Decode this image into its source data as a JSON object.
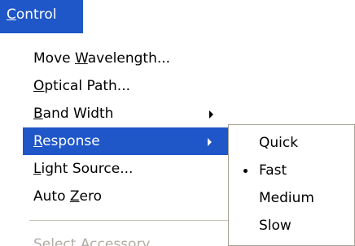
{
  "menubar": {
    "active_menu": {
      "mnemonic": "C",
      "rest": "ontrol"
    }
  },
  "menu": {
    "items": [
      {
        "pre": "Move ",
        "mnemonic": "W",
        "post": "avelength...",
        "state": "normal",
        "has_submenu": false
      },
      {
        "pre": "",
        "mnemonic": "O",
        "post": "ptical Path...",
        "state": "normal",
        "has_submenu": false
      },
      {
        "pre": "",
        "mnemonic": "B",
        "post": "and Width",
        "state": "normal",
        "has_submenu": true
      },
      {
        "pre": "",
        "mnemonic": "R",
        "post": "esponse",
        "state": "highlighted",
        "has_submenu": true
      },
      {
        "pre": "",
        "mnemonic": "L",
        "post": "ight Source...",
        "state": "normal",
        "has_submenu": false
      },
      {
        "pre": "Auto ",
        "mnemonic": "Z",
        "post": "ero",
        "state": "normal",
        "has_submenu": false
      }
    ],
    "disabled_item": {
      "label": "Select Accessory..."
    }
  },
  "submenu": {
    "items": [
      {
        "label": "Quick",
        "checked": false
      },
      {
        "label": "Fast",
        "checked": true
      },
      {
        "label": "Medium",
        "checked": false
      },
      {
        "label": "Slow",
        "checked": false
      }
    ]
  },
  "colors": {
    "highlight": "#1f56c8",
    "disabled_text": "#b0aca4"
  }
}
